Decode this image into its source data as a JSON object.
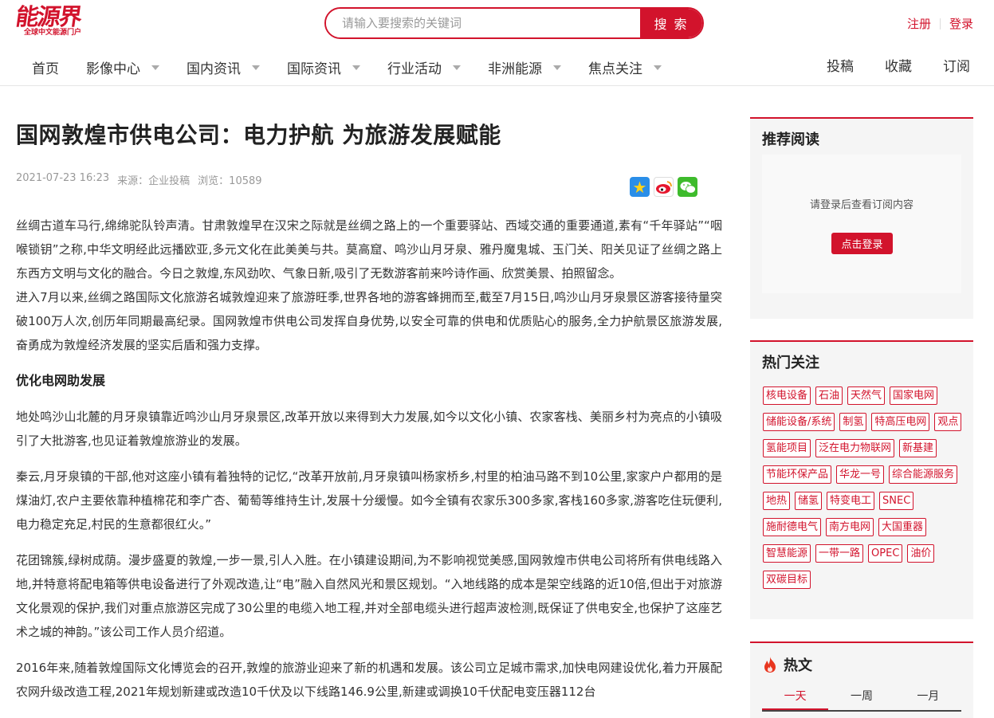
{
  "logo": {
    "main": "能源界",
    "sub": "全球中文能源门户"
  },
  "search": {
    "placeholder": "请输入要搜索的关键词",
    "button": "搜 索"
  },
  "auth": {
    "register": "注册",
    "login": "登录"
  },
  "nav": {
    "items": [
      {
        "label": "首页",
        "dropdown": false
      },
      {
        "label": "影像中心",
        "dropdown": true
      },
      {
        "label": "国内资讯",
        "dropdown": true
      },
      {
        "label": "国际资讯",
        "dropdown": true
      },
      {
        "label": "行业活动",
        "dropdown": true
      },
      {
        "label": "非洲能源",
        "dropdown": true
      },
      {
        "label": "焦点关注",
        "dropdown": true
      }
    ],
    "right": [
      "投稿",
      "收藏",
      "订阅"
    ]
  },
  "article": {
    "title": "国网敦煌市供电公司：电力护航 为旅游发展赋能",
    "date": "2021-07-23 16:23",
    "source": "来源：企业投稿",
    "views": "浏览：10589",
    "paragraphs": [
      "丝绸古道车马行,绵绵驼队铃声清。甘肃敦煌早在汉宋之际就是丝绸之路上的一个重要驿站、西域交通的重要通道,素有“千年驿站”“咽喉锁钥”之称,中华文明经此远播欧亚,多元文化在此美美与共。莫高窟、鸣沙山月牙泉、雅丹魔鬼城、玉门关、阳关见证了丝绸之路上东西方文明与文化的融合。今日之敦煌,东风劲吹、气象日新,吸引了无数游客前来吟诗作画、欣赏美景、拍照留念。",
      "进入7月以来,丝绸之路国际文化旅游名城敦煌迎来了旅游旺季,世界各地的游客蜂拥而至,截至7月15日,鸣沙山月牙泉景区游客接待量突破100万人次,创历年同期最高纪录。国网敦煌市供电公司发挥自身优势,以安全可靠的供电和优质贴心的服务,全力护航景区旅游发展,奋勇成为敦煌经济发展的坚实后盾和强力支撑。",
      "优化电网助发展",
      "地处鸣沙山北麓的月牙泉镇靠近鸣沙山月牙泉景区,改革开放以来得到大力发展,如今以文化小镇、农家客栈、美丽乡村为亮点的小镇吸引了大批游客,也见证着敦煌旅游业的发展。",
      "秦云,月牙泉镇的干部,他对这座小镇有着独特的记忆,“改革开放前,月牙泉镇叫杨家桥乡,村里的柏油马路不到10公里,家家户户都用的是煤油灯,农户主要依靠种植棉花和李广杏、葡萄等维持生计,发展十分缓慢。如今全镇有农家乐300多家,客栈160多家,游客吃住玩便利,电力稳定充足,村民的生意都很红火。”",
      "花团锦簇,绿树成荫。漫步盛夏的敦煌,一步一景,引人入胜。在小镇建设期间,为不影响视觉美感,国网敦煌市供电公司将所有供电线路入地,并特意将配电箱等供电设备进行了外观改造,让“电”融入自然风光和景区规划。“入地线路的成本是架空线路的近10倍,但出于对旅游文化景观的保护,我们对重点旅游区完成了30公里的电缆入地工程,并对全部电缆头进行超声波检测,既保证了供电安全,也保护了这座艺术之城的神韵。”该公司工作人员介绍道。",
      "2016年来,随着敦煌国际文化博览会的召开,敦煌的旅游业迎来了新的机遇和发展。该公司立足城市需求,加快电网建设优化,着力开展配农网升级改造工程,2021年规划新建或改造10千伏及以下线路146.9公里,新建或调换10千伏配电变压器112台"
    ]
  },
  "sidebar": {
    "recommend": {
      "title": "推荐阅读",
      "message": "请登录后查看订阅内容",
      "button": "点击登录"
    },
    "hot": {
      "title": "热门关注",
      "tags": [
        "核电设备",
        "石油",
        "天然气",
        "国家电网",
        "储能设备/系统",
        "制氢",
        "特高压电网",
        "观点",
        "氢能项目",
        "泛在电力物联网",
        "新基建",
        "节能环保产品",
        "华龙一号",
        "综合能源服务",
        "地热",
        "储氢",
        "特变电工",
        "SNEC",
        "施耐德电气",
        "南方电网",
        "大国重器",
        "智慧能源",
        "一带一路",
        "OPEC",
        "油价",
        "双碳目标"
      ]
    },
    "hotnews": {
      "title": "热文",
      "tabs": [
        "一天",
        "一周",
        "一月"
      ]
    }
  },
  "colors": {
    "brand": "#d2132c"
  }
}
